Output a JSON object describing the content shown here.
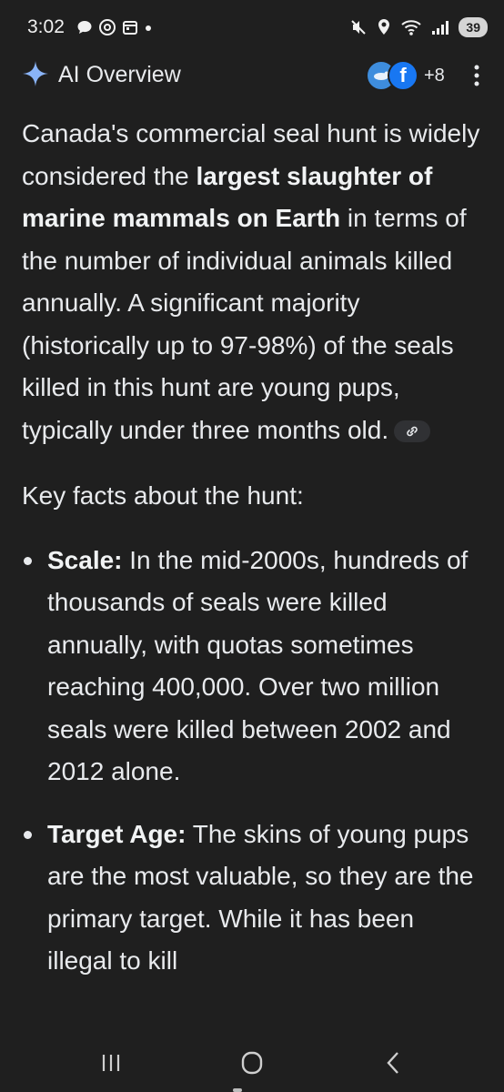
{
  "status_bar": {
    "time": "3:02",
    "battery": "39",
    "icons": [
      "chat-bubble-icon",
      "threads-icon",
      "calendar-icon",
      "dot-icon",
      "mute-icon",
      "location-icon",
      "wifi-icon",
      "signal-icon"
    ]
  },
  "header": {
    "title": "AI Overview",
    "sources_more": "+8",
    "icons": [
      "sparkle-icon",
      "more-vert-icon"
    ]
  },
  "intro": {
    "t1": "Canada's commercial seal hunt is widely considered the ",
    "b1": "largest slaughter of marine mammals on Earth",
    "t2": " in terms of the number of individual animals killed annually. A significant majority (historically up to 97-98%) of the seals killed in this hunt are young pups, typically under three months old."
  },
  "key_facts_heading": "Key facts about the hunt:",
  "bullets": [
    {
      "label": "Scale:",
      "text": " In the mid-2000s, hundreds of thousands of seals were killed annually, with quotas sometimes reaching 400,000. Over two million seals were killed between 2002 and 2012 alone."
    },
    {
      "label": "Target Age:",
      "text": " The skins of young pups are the most valuable, so they are the primary target. While it has been illegal to kill"
    }
  ],
  "colors": {
    "background": "#1f1f1f",
    "text": "#e8eaed",
    "accent_sparkle": "#8ab4f8"
  }
}
